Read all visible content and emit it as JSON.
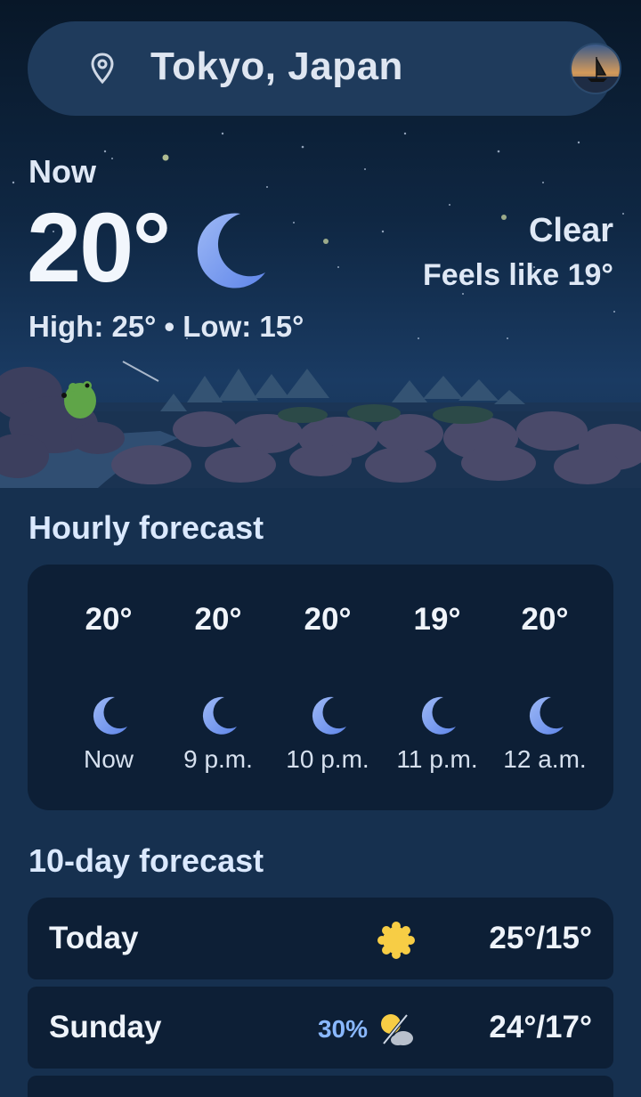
{
  "colors": {
    "background": "#16304f",
    "card": "#0d1f36",
    "moon": "#7ba2f0",
    "sun": "#f7cd45",
    "precip_text": "#8ab8ff"
  },
  "search": {
    "location": "Tokyo, Japan",
    "location_icon": "location-pin-icon",
    "avatar": "profile-avatar"
  },
  "current": {
    "label": "Now",
    "temperature": "20°",
    "condition_icon": "moon-icon",
    "condition": "Clear",
    "feels_like": "Feels like 19°",
    "high_low": "High: 25° • Low: 15°"
  },
  "hourly": {
    "title": "Hourly forecast",
    "items": [
      {
        "temp": "20°",
        "time": "Now",
        "icon": "moon-icon"
      },
      {
        "temp": "20°",
        "time": "9 p.m.",
        "icon": "moon-icon"
      },
      {
        "temp": "20°",
        "time": "10 p.m.",
        "icon": "moon-icon"
      },
      {
        "temp": "19°",
        "time": "11 p.m.",
        "icon": "moon-icon"
      },
      {
        "temp": "20°",
        "time": "12 a.m.",
        "icon": "moon-icon"
      }
    ]
  },
  "daily": {
    "title": "10-day forecast",
    "items": [
      {
        "day": "Today",
        "precip": "",
        "icon": "sun-icon",
        "temps": "25°/15°"
      },
      {
        "day": "Sunday",
        "precip": "30%",
        "icon": "partly-cloudy-icon",
        "temps": "24°/17°"
      }
    ]
  }
}
